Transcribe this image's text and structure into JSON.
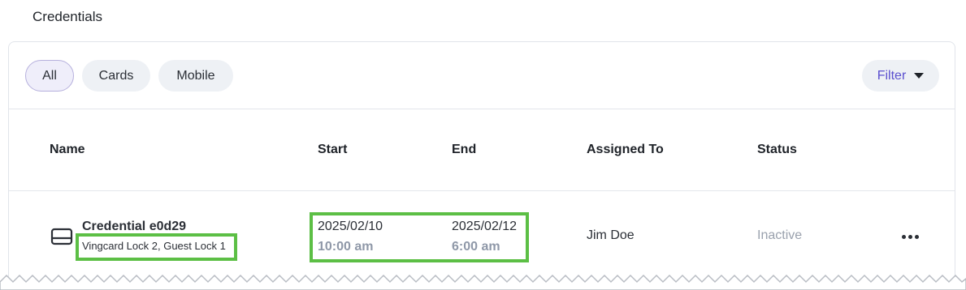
{
  "section": {
    "title": "Credentials"
  },
  "tabs": [
    {
      "label": "All",
      "active": true
    },
    {
      "label": "Cards",
      "active": false
    },
    {
      "label": "Mobile",
      "active": false
    }
  ],
  "filter": {
    "label": "Filter",
    "icon": "caret-down-icon"
  },
  "table": {
    "columns": [
      "Name",
      "Start",
      "End",
      "Assigned To",
      "Status"
    ],
    "rows": [
      {
        "icon": "card-icon",
        "name": "Credential e0d29",
        "locks": "Vingcard Lock 2, Guest Lock 1",
        "start_date": "2025/02/10",
        "start_time": "10:00 am",
        "end_date": "2025/02/12",
        "end_time": "6:00 am",
        "assigned_to": "Jim Doe",
        "status": "Inactive"
      }
    ]
  },
  "colors": {
    "accent": "#5a4fcf",
    "highlight": "#5cbf45",
    "chip_bg": "#eef1f5",
    "muted": "#8f98a8"
  }
}
